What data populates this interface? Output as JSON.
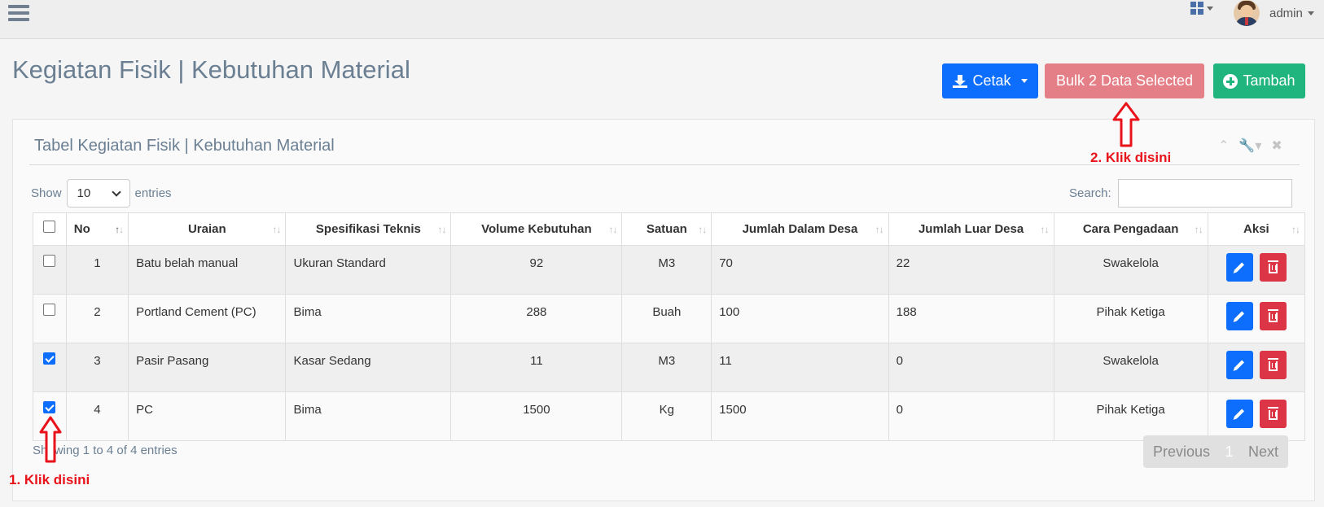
{
  "header": {
    "user_label": "admin"
  },
  "page": {
    "title": "Kegiatan Fisik | Kebutuhan Material"
  },
  "actions": {
    "cetak_label": "Cetak",
    "bulk_label": "Bulk 2 Data Selected",
    "tambah_label": "Tambah"
  },
  "panel": {
    "title": "Tabel Kegiatan Fisik | Kebutuhan Material"
  },
  "controls": {
    "show_label": "Show",
    "entries_value": "10",
    "entries_label": "entries",
    "search_label": "Search:"
  },
  "table": {
    "headers": [
      "No",
      "Uraian",
      "Spesifikasi Teknis",
      "Volume Kebutuhan",
      "Satuan",
      "Jumlah Dalam Desa",
      "Jumlah Luar Desa",
      "Cara Pengadaan",
      "Aksi"
    ],
    "rows": [
      {
        "no": "1",
        "uraian": "Batu belah manual",
        "spesifikasi": "Ukuran Standard",
        "volume": "92",
        "satuan": "M3",
        "dalam": "70",
        "luar": "22",
        "cara": "Swakelola",
        "checked": false
      },
      {
        "no": "2",
        "uraian": "Portland Cement (PC)",
        "spesifikasi": "Bima",
        "volume": "288",
        "satuan": "Buah",
        "dalam": "100",
        "luar": "188",
        "cara": "Pihak Ketiga",
        "checked": false
      },
      {
        "no": "3",
        "uraian": "Pasir Pasang",
        "spesifikasi": "Kasar Sedang",
        "volume": "11",
        "satuan": "M3",
        "dalam": "11",
        "luar": "0",
        "cara": "Swakelola",
        "checked": true
      },
      {
        "no": "4",
        "uraian": "PC",
        "spesifikasi": "Bima",
        "volume": "1500",
        "satuan": "Kg",
        "dalam": "1500",
        "luar": "0",
        "cara": "Pihak Ketiga",
        "checked": true
      }
    ]
  },
  "footer": {
    "info": "Showing 1 to 4 of 4 entries",
    "previous_label": "Previous",
    "current_page": "1",
    "next_label": "Next"
  },
  "annotations": {
    "step1": "1. Klik disini",
    "step2": "2. Klik disini",
    "color": "#e8131b"
  },
  "colors": {
    "primary": "#0d6efd",
    "bulk": "#e57f87",
    "success": "#20b57f",
    "danger": "#dc3545"
  }
}
